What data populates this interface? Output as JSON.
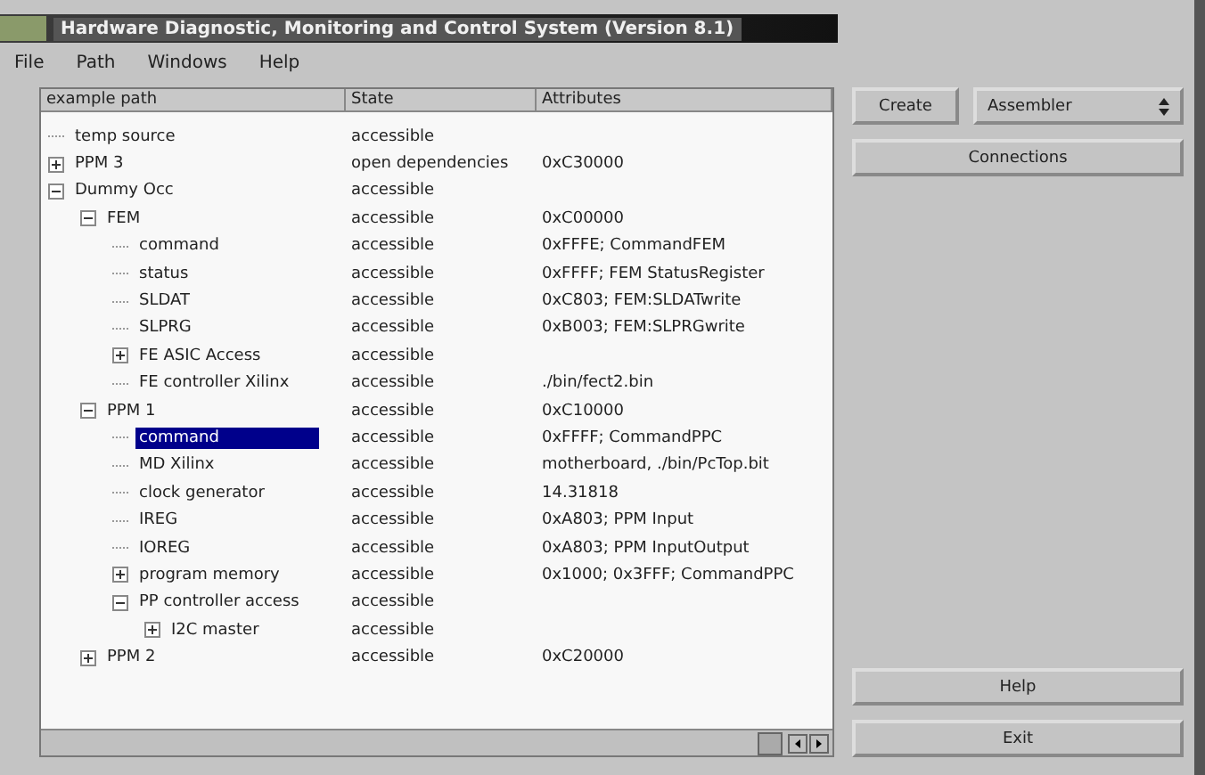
{
  "window": {
    "title": "Hardware Diagnostic, Monitoring and Control System (Version 8.1)"
  },
  "menu": [
    "File",
    "Path",
    "Windows",
    "Help"
  ],
  "table": {
    "columns": [
      "example path",
      "State",
      "Attributes"
    ],
    "rows": [
      {
        "name": "temp source",
        "state": "accessible",
        "selected": false
      },
      {
        "name": "PPM 3",
        "state": "open dependencies",
        "attributes": "0xC30000",
        "selected": false,
        "expanded": false
      },
      {
        "name": "Dummy Occ",
        "state": "accessible",
        "selected": false,
        "expanded": true,
        "children": [
          {
            "name": "FEM",
            "state": "accessible",
            "attributes": "0xC00000",
            "selected": false,
            "expanded": true,
            "children": [
              {
                "name": "command",
                "state": "accessible",
                "attributes": "0xFFFE; CommandFEM",
                "selected": false
              },
              {
                "name": "status",
                "state": "accessible",
                "attributes": "0xFFFF; FEM StatusRegister",
                "selected": false
              },
              {
                "name": "SLDAT",
                "state": "accessible",
                "attributes": "0xC803; FEM:SLDATwrite",
                "selected": false
              },
              {
                "name": "SLPRG",
                "state": "accessible",
                "attributes": "0xB003; FEM:SLPRGwrite",
                "selected": false
              },
              {
                "name": "FE ASIC Access",
                "state": "accessible",
                "selected": false,
                "expanded": false
              },
              {
                "name": "FE controller Xilinx",
                "state": "accessible",
                "attributes": "./bin/fect2.bin",
                "selected": false
              }
            ]
          },
          {
            "name": "PPM 1",
            "state": "accessible",
            "attributes": "0xC10000",
            "selected": false,
            "expanded": true,
            "children": [
              {
                "name": "command",
                "state": "accessible",
                "attributes": "0xFFFF; CommandPPC",
                "selected": true
              },
              {
                "name": "MD Xilinx",
                "state": "accessible",
                "attributes": "motherboard, ./bin/PcTop.bit",
                "selected": false
              },
              {
                "name": "clock generator",
                "state": "accessible",
                "attributes": "14.31818",
                "selected": false
              },
              {
                "name": "IREG",
                "state": "accessible",
                "attributes": "0xA803; PPM Input",
                "selected": false
              },
              {
                "name": "IOREG",
                "state": "accessible",
                "attributes": "0xA803; PPM InputOutput",
                "selected": false
              },
              {
                "name": "program memory",
                "state": "accessible",
                "attributes": "0x1000; 0x3FFF; CommandPPC",
                "selected": false,
                "expanded": false
              },
              {
                "name": "PP controller access",
                "state": "accessible",
                "selected": false,
                "expanded": true,
                "children": [
                  {
                    "name": "I2C master",
                    "state": "accessible",
                    "selected": false,
                    "expanded": false
                  }
                ]
              }
            ]
          },
          {
            "name": "PPM 2",
            "state": "accessible",
            "attributes": "0xC20000",
            "selected": false,
            "expanded": false
          }
        ]
      }
    ]
  },
  "create_button": "Create",
  "dropdown": {
    "value": "Assembler"
  },
  "buttons": [
    "Connections",
    "Help",
    "Exit"
  ]
}
